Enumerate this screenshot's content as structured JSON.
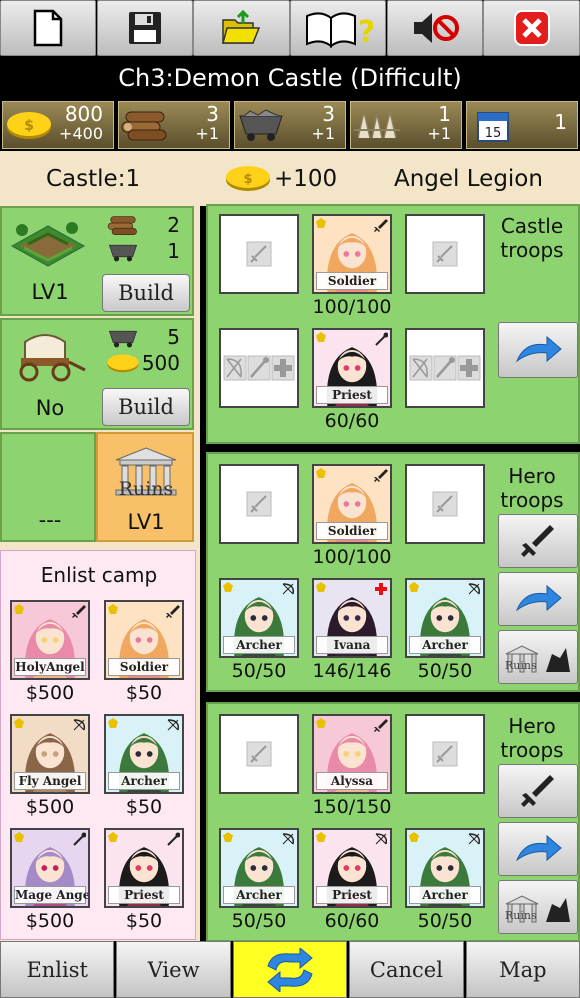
{
  "toolbar": {
    "icons": [
      "new-file-icon",
      "save-icon",
      "open-folder-icon",
      "help-book-icon",
      "sound-off-icon",
      "close-icon"
    ]
  },
  "title": "Ch3:Demon Castle (Difficult)",
  "resources": [
    {
      "icon": "gold-coin-icon",
      "value": "800",
      "income": "+400"
    },
    {
      "icon": "wood-logs-icon",
      "value": "3",
      "income": "+1"
    },
    {
      "icon": "ore-cart-icon",
      "value": "3",
      "income": "+1"
    },
    {
      "icon": "stakes-icon",
      "value": "1",
      "income": "+1"
    },
    {
      "icon": "calendar-icon",
      "value": "1",
      "income": ""
    }
  ],
  "header": {
    "castle": "Castle:1",
    "gold_bonus": "+100",
    "faction": "Angel Legion"
  },
  "buildings": {
    "farm": {
      "level": "LV1",
      "wood": "2",
      "ore": "1",
      "build_label": "Build"
    },
    "wagon": {
      "status": "No",
      "ore": "5",
      "gold": "500",
      "build_label": "Build"
    },
    "ruins": {
      "empty": "---",
      "label": "Ruins",
      "level": "LV1"
    }
  },
  "enlist_camp": {
    "title": "Enlist camp",
    "units": [
      {
        "name": "HolyAngel",
        "price": "$500"
      },
      {
        "name": "Soldier",
        "price": "$50"
      },
      {
        "name": "Fly Angel",
        "price": "$500"
      },
      {
        "name": "Archer",
        "price": "$50"
      },
      {
        "name": "Mage Angel",
        "price": "$500"
      },
      {
        "name": "Priest",
        "price": "$50"
      }
    ]
  },
  "castle_troops": {
    "title_1": "Castle",
    "title_2": "troops",
    "units": [
      {
        "name": "Soldier",
        "hp": "100/100"
      },
      {
        "name": "Priest",
        "hp": "60/60"
      }
    ]
  },
  "hero_troops_1": {
    "title_1": "Hero",
    "title_2": "troops",
    "ruins_label": "Ruins",
    "units": [
      {
        "name": "Soldier",
        "hp": "100/100"
      },
      {
        "name": "Archer",
        "hp": "50/50"
      },
      {
        "name": "Ivana",
        "hp": "146/146"
      },
      {
        "name": "Archer",
        "hp": "50/50"
      }
    ]
  },
  "hero_troops_2": {
    "title_1": "Hero",
    "title_2": "troops",
    "ruins_label": "Ruins",
    "units": [
      {
        "name": "Alyssa",
        "hp": "150/150"
      },
      {
        "name": "Archer",
        "hp": "50/50"
      },
      {
        "name": "Priest",
        "hp": "60/60"
      },
      {
        "name": "Archer",
        "hp": "50/50"
      }
    ]
  },
  "bottom_bar": {
    "enlist": "Enlist",
    "view": "View",
    "cancel": "Cancel",
    "map": "Map"
  }
}
